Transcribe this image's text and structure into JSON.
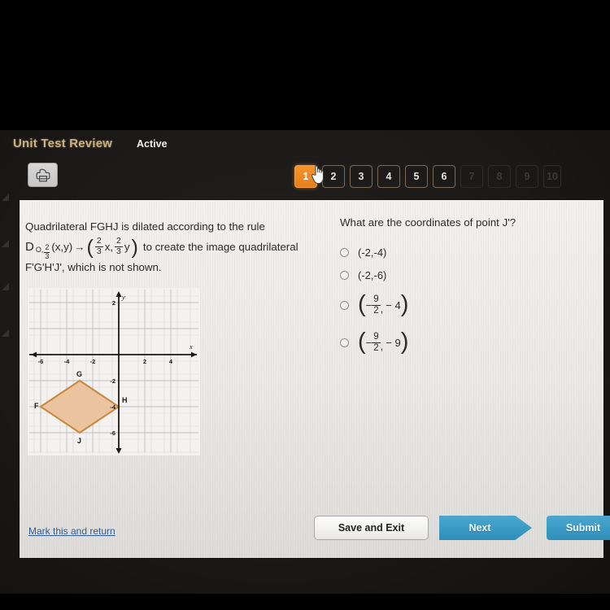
{
  "header": {
    "title": "Unit Test Review",
    "status": "Active"
  },
  "toolbar": {
    "print_icon": "printer-icon",
    "cursor_icon": "hand-pointer-cursor"
  },
  "pagination": {
    "items": [
      {
        "label": "1",
        "state": "active"
      },
      {
        "label": "2",
        "state": "enabled"
      },
      {
        "label": "3",
        "state": "enabled"
      },
      {
        "label": "4",
        "state": "enabled"
      },
      {
        "label": "5",
        "state": "enabled"
      },
      {
        "label": "6",
        "state": "enabled"
      },
      {
        "label": "7",
        "state": "disabled"
      },
      {
        "label": "8",
        "state": "disabled"
      },
      {
        "label": "9",
        "state": "disabled"
      },
      {
        "label": "10",
        "state": "disabled"
      }
    ]
  },
  "question": {
    "line1": "Quadrilateral FGHJ is dilated according to the rule",
    "rule": {
      "d_symbol": "D",
      "subscript_center": "O,",
      "subscript_scale_num": "2",
      "subscript_scale_den": "3",
      "mapping_input": "(x,y)",
      "arrow": "→",
      "img_num1": "2",
      "img_den1": "3",
      "img_var1": "x,",
      "img_num2": "2",
      "img_den2": "3",
      "img_var2": "y",
      "tail": "to create the image quadrilateral"
    },
    "line3": "F'G'H'J', which is not shown.",
    "prompt": "What are the coordinates of point J'?"
  },
  "choices": [
    {
      "id": "a",
      "text": "(-2,-4)",
      "type": "plain",
      "selected": false
    },
    {
      "id": "b",
      "text": "(-2,-6)",
      "type": "plain",
      "selected": false
    },
    {
      "id": "c",
      "type": "fraction",
      "selected": false,
      "neg": "−",
      "num": "9",
      "den": "2",
      "comma": ",",
      "second": "− 4"
    },
    {
      "id": "d",
      "type": "fraction",
      "selected": false,
      "neg": "−",
      "num": "9",
      "den": "2",
      "comma": ",",
      "second": "− 9"
    }
  ],
  "chart_data": {
    "type": "scatter",
    "title": "",
    "xlabel": "x",
    "ylabel": "y",
    "xlim": [
      -7,
      5
    ],
    "ylim": [
      -7,
      3
    ],
    "xticks": [
      -6,
      -4,
      -2,
      2,
      4
    ],
    "yticks": [
      2,
      -2,
      -4,
      -6
    ],
    "grid": true,
    "shape": {
      "name": "FGHJ",
      "fill": "#eac49f",
      "stroke": "#c8883f",
      "vertices": [
        {
          "label": "F",
          "x": -6,
          "y": -4
        },
        {
          "label": "G",
          "x": -3,
          "y": -2
        },
        {
          "label": "H",
          "x": 0,
          "y": -4
        },
        {
          "label": "J",
          "x": -3,
          "y": -6
        }
      ]
    }
  },
  "footer": {
    "mark_link": "Mark this and return",
    "save_label": "Save and Exit",
    "next_label": "Next",
    "submit_label": "Submit"
  },
  "colors": {
    "accent_orange": "#f0912a",
    "accent_blue": "#3a9ac4",
    "title_gold": "#c9b07f",
    "link_blue": "#2f5d96",
    "shape_fill": "#eac49f"
  }
}
